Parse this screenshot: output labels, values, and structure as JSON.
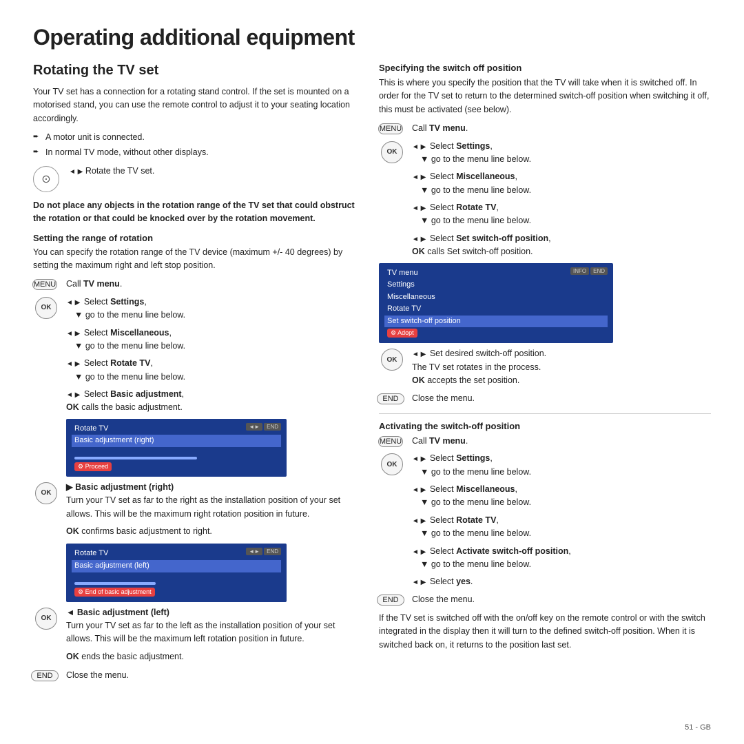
{
  "page": {
    "title": "Operating additional equipment",
    "subtitle": "Rotating the TV set",
    "footer": "51 - GB"
  },
  "left": {
    "intro": "Your TV set has a connection for a rotating stand control. If the set is mounted on a motorised stand, you can use the remote control to adjust it to your seating location accordingly.",
    "bullets": [
      "A motor unit is connected.",
      "In normal TV mode, without other displays."
    ],
    "rotate_instruction": "◄ ▶ Rotate the TV set.",
    "warning": "Do not place any objects in the rotation range of the TV set that could obstruct the rotation or that could be knocked over by the rotation movement.",
    "section_range": "Setting the range of rotation",
    "range_text": "You can specify the rotation range of the TV device (maximum +/- 40 degrees) by setting the maximum right and left stop position.",
    "steps": [
      {
        "btn": "MENU",
        "type": "menu",
        "text": "Call TV menu."
      },
      {
        "btn": "OK",
        "type": "ok",
        "arrows": "◄ ▶ Select Settings,",
        "sub": "go to the menu line below."
      },
      {
        "btn": null,
        "type": null,
        "arrows": "◄ ▶ Select Miscellaneous,",
        "sub": "go to the menu line below."
      },
      {
        "btn": null,
        "type": null,
        "arrows": "◄ ▶ Select Rotate TV,",
        "sub": "go to the menu line below."
      },
      {
        "btn": null,
        "type": null,
        "arrows": "◄ ▶ Select Basic adjustment,",
        "sub_ok": "OK calls the basic adjustment."
      }
    ],
    "screen1": {
      "title": "Rotate TV",
      "rows": [
        "Basic adjustment (right)",
        ""
      ],
      "highlighted": "Basic adjustment (right)",
      "progress": true,
      "bottom_label": "Proceed"
    },
    "basic_right_title": "▶ Basic adjustment (right)",
    "basic_right_text": "Turn your TV set as far to the right as the installation position of your set allows. This will be the maximum right rotation position in future.",
    "ok_confirms_right": "OK confirms basic adjustment to right.",
    "screen2": {
      "title": "Rotate TV",
      "rows": [
        "Basic adjustment (left)",
        ""
      ],
      "highlighted": "Basic adjustment (left)",
      "progress": true,
      "bottom_label": "End of basic adjustment"
    },
    "basic_left_title": "◄ Basic adjustment (left)",
    "basic_left_text": "Turn your TV set as far to the left as the installation position of your set allows. This will be the maximum left rotation position in future.",
    "ok_ends": "OK ends the basic adjustment.",
    "close_menu": "Close the menu."
  },
  "right": {
    "section_switch_off": "Specifying the switch off position",
    "switch_off_intro": "This is where you specify the position that the TV will take when it is switched off. In order for the TV set to return to the determined switch-off position when switching it off, this must be activated (see below).",
    "steps_switch_off": [
      {
        "btn": "MENU",
        "type": "menu",
        "text": "Call TV menu."
      },
      {
        "btn": "OK",
        "type": "ok",
        "arrows": "◄ ▶ Select Settings,",
        "sub": "go to the menu line below."
      },
      {
        "btn": null,
        "type": null,
        "arrows": "◄ ▶ Select Miscellaneous,",
        "sub": "go to the menu line below."
      },
      {
        "btn": null,
        "type": null,
        "arrows": "◄ ▶ Select Rotate TV,",
        "sub": "go to the menu line below."
      },
      {
        "btn": null,
        "type": null,
        "arrows": "◄ ▶ Select Set switch-off position,",
        "sub_ok": "OK calls Set switch-off position."
      }
    ],
    "screen_switch": {
      "rows": [
        "TV menu",
        "Settings",
        "Miscellaneous",
        "Rotate TV",
        "Set switch-off position"
      ],
      "highlighted": "Set switch-off position",
      "bottom_label": "Adopt"
    },
    "steps_after_screen": [
      {
        "btn": "OK",
        "type": "ok",
        "arrows": "◄ ▶ Set desired switch-off position.",
        "sub": "The TV set rotates in the process.",
        "sub_ok": "OK accepts the set position."
      }
    ],
    "close_menu_end": "Close the menu.",
    "section_activate": "Activating the switch-off position",
    "activate_steps": [
      {
        "btn": "MENU",
        "type": "menu",
        "text": "Call TV menu."
      },
      {
        "btn": "OK",
        "type": "ok",
        "arrows": "◄ ▶ Select Settings,",
        "sub": "go to the menu line below."
      },
      {
        "btn": null,
        "type": null,
        "arrows": "◄ ▶ Select Miscellaneous,",
        "sub": "go to the menu line below."
      },
      {
        "btn": null,
        "type": null,
        "arrows": "◄ ▶ Select Rotate TV,",
        "sub": "go to the menu line below."
      },
      {
        "btn": null,
        "type": null,
        "arrows": "◄ ▶ Select Activate switch-off position,",
        "sub": "go to the menu line below."
      },
      {
        "btn": null,
        "type": null,
        "arrows": "◄ ▶ Select yes."
      }
    ],
    "close_menu_activate": "Close the menu.",
    "final_text": "If the TV set is switched off with the on/off key on the remote control or with the switch integrated in the display then it will turn to the defined switch-off position. When it is switched back on, it returns to the position last set."
  }
}
